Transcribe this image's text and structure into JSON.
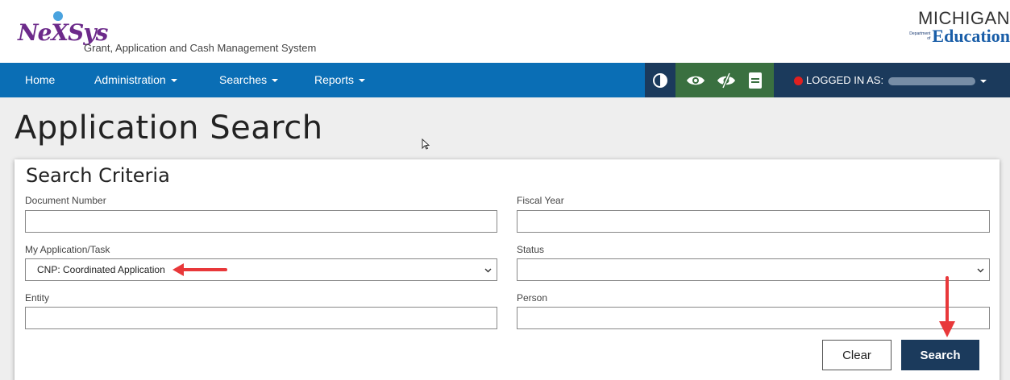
{
  "header": {
    "logo_text": "NeXSys",
    "app_name": "Grant, Application and Cash Management System",
    "mde_michigan": "MICHIGAN",
    "mde_department": "Department of",
    "mde_education": "Education"
  },
  "nav": {
    "home": "Home",
    "administration": "Administration",
    "searches": "Searches",
    "reports": "Reports",
    "logged_in_label": "LOGGED IN AS:"
  },
  "tools": {
    "contrast_icon": "contrast-icon",
    "eye_icon": "eye-icon",
    "eye_slash_icon": "eye-slash-icon",
    "book_icon": "book-icon"
  },
  "page": {
    "title": "Application Search"
  },
  "criteria": {
    "title": "Search Criteria",
    "document_number_label": "Document Number",
    "document_number_value": "",
    "fiscal_year_label": "Fiscal Year",
    "fiscal_year_value": "",
    "my_application_label": "My Application/Task",
    "my_application_value": "CNP: Coordinated Application",
    "status_label": "Status",
    "status_value": "",
    "entity_label": "Entity",
    "entity_value": "",
    "person_label": "Person",
    "person_value": "",
    "clear_label": "Clear",
    "search_label": "Search"
  },
  "colors": {
    "nav_blue": "#0a6eb5",
    "dark_navy": "#1b3a5c",
    "tool_green": "#3a7040",
    "annotation_red": "#e8383a"
  }
}
